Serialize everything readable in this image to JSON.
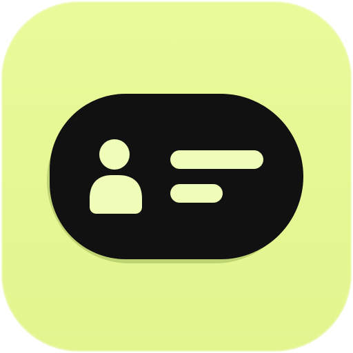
{
  "icon": {
    "type": "contact-card-icon",
    "colors": {
      "tile": "#e6f896",
      "card": "#111111",
      "accent": "#eefdb8"
    }
  }
}
